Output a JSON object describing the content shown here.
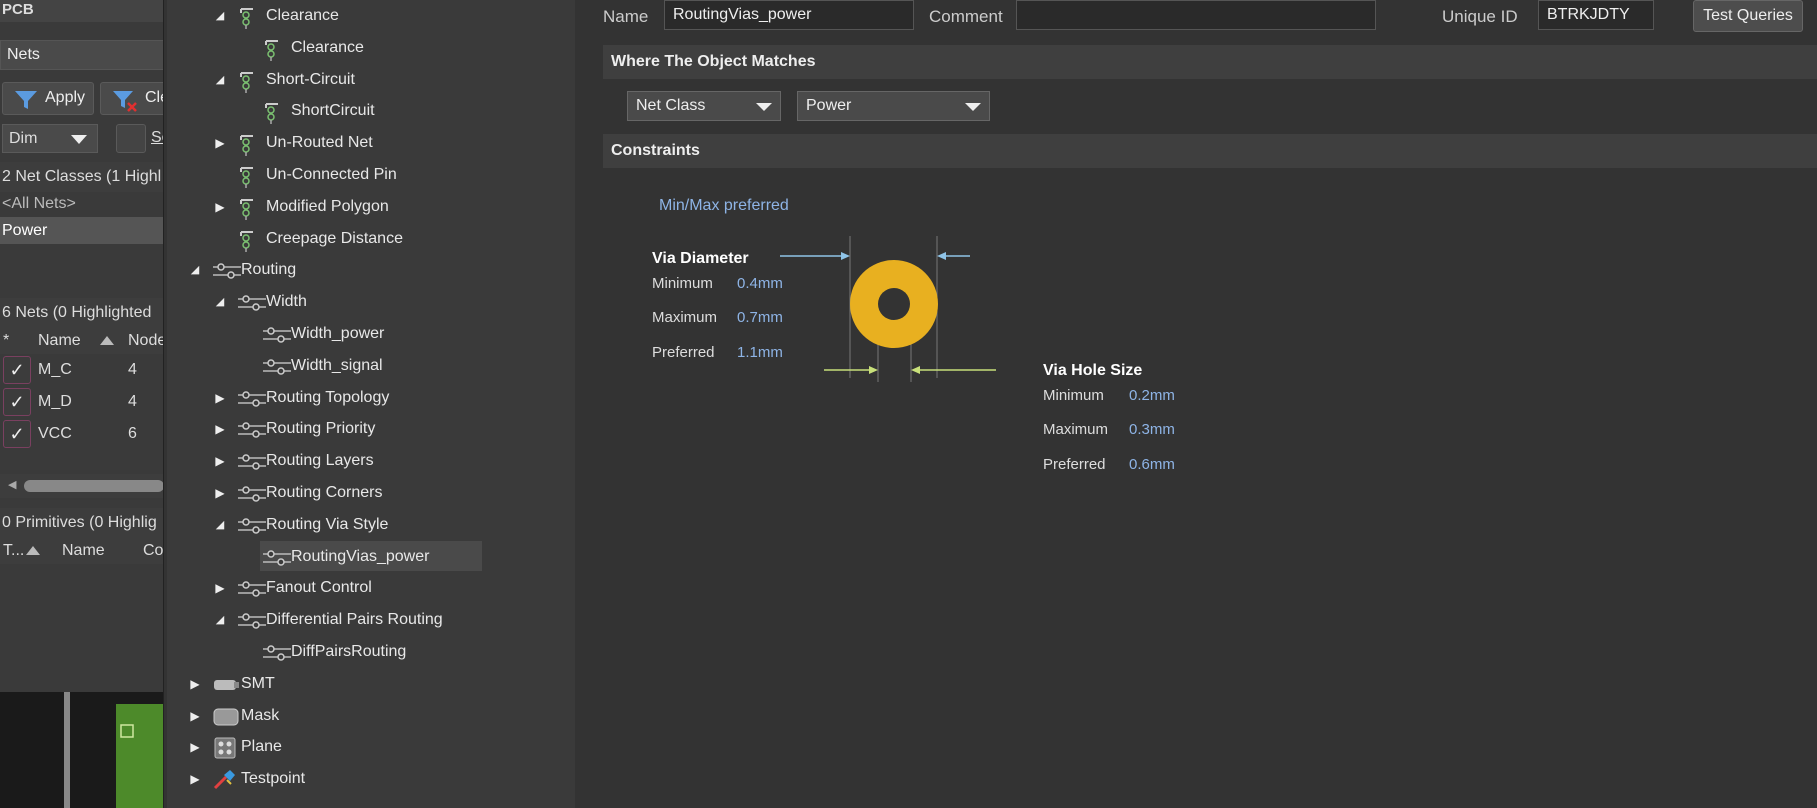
{
  "left_panel": {
    "title": "PCB",
    "mode_dropdown": "Nets",
    "apply_label": "Apply",
    "clear_label": "Cle",
    "dim_dropdown": "Dim",
    "select_label": "Se",
    "net_classes_header": "2 Net Classes (1 Highl",
    "net_classes": [
      "<All Nets>",
      "Power"
    ],
    "selected_net_class": "Power",
    "nets_header": "6 Nets (0 Highlighted",
    "nets_columns": [
      "*",
      "Name",
      "Node"
    ],
    "nets": [
      {
        "name": "M_C",
        "nodes": "4"
      },
      {
        "name": "M_D",
        "nodes": "4"
      },
      {
        "name": "VCC",
        "nodes": "6"
      }
    ],
    "primitives_header": "0 Primitives (0 Highlig",
    "primitives_columns": [
      "T...",
      "Name",
      "Co"
    ]
  },
  "tree": {
    "items": [
      {
        "label": "Clearance",
        "level": 2,
        "arrow": "expanded",
        "icon": "rule-group-icon"
      },
      {
        "label": "Clearance",
        "level": 3,
        "arrow": "none",
        "icon": "rule-icon"
      },
      {
        "label": "Short-Circuit",
        "level": 2,
        "arrow": "expanded",
        "icon": "rule-group-icon"
      },
      {
        "label": "ShortCircuit",
        "level": 3,
        "arrow": "none",
        "icon": "rule-icon"
      },
      {
        "label": "Un-Routed Net",
        "level": 2,
        "arrow": "collapsed",
        "icon": "rule-group-icon"
      },
      {
        "label": "Un-Connected Pin",
        "level": 2,
        "arrow": "none",
        "icon": "rule-group-icon"
      },
      {
        "label": "Modified Polygon",
        "level": 2,
        "arrow": "collapsed",
        "icon": "rule-group-icon"
      },
      {
        "label": "Creepage Distance",
        "level": 2,
        "arrow": "none",
        "icon": "rule-group-icon"
      },
      {
        "label": "Routing",
        "level": 1,
        "arrow": "expanded",
        "icon": "routing-icon"
      },
      {
        "label": "Width",
        "level": 2,
        "arrow": "expanded",
        "icon": "routing-icon"
      },
      {
        "label": "Width_power",
        "level": 3,
        "arrow": "none",
        "icon": "routing-icon"
      },
      {
        "label": "Width_signal",
        "level": 3,
        "arrow": "none",
        "icon": "routing-icon"
      },
      {
        "label": "Routing Topology",
        "level": 2,
        "arrow": "collapsed",
        "icon": "routing-icon"
      },
      {
        "label": "Routing Priority",
        "level": 2,
        "arrow": "collapsed",
        "icon": "routing-icon"
      },
      {
        "label": "Routing Layers",
        "level": 2,
        "arrow": "collapsed",
        "icon": "routing-icon"
      },
      {
        "label": "Routing Corners",
        "level": 2,
        "arrow": "collapsed",
        "icon": "routing-icon"
      },
      {
        "label": "Routing Via Style",
        "level": 2,
        "arrow": "expanded",
        "icon": "routing-icon"
      },
      {
        "label": "RoutingVias_power",
        "level": 3,
        "arrow": "none",
        "icon": "routing-icon",
        "selected": true
      },
      {
        "label": "Fanout Control",
        "level": 2,
        "arrow": "collapsed",
        "icon": "routing-icon"
      },
      {
        "label": "Differential Pairs Routing",
        "level": 2,
        "arrow": "expanded",
        "icon": "routing-icon"
      },
      {
        "label": "DiffPairsRouting",
        "level": 3,
        "arrow": "none",
        "icon": "routing-icon"
      },
      {
        "label": "SMT",
        "level": 1,
        "arrow": "collapsed",
        "icon": "smt-icon"
      },
      {
        "label": "Mask",
        "level": 1,
        "arrow": "collapsed",
        "icon": "mask-icon"
      },
      {
        "label": "Plane",
        "level": 1,
        "arrow": "collapsed",
        "icon": "plane-icon"
      },
      {
        "label": "Testpoint",
        "level": 1,
        "arrow": "collapsed",
        "icon": "testpoint-icon"
      }
    ]
  },
  "rule": {
    "name_label": "Name",
    "name_value": "RoutingVias_power",
    "comment_label": "Comment",
    "comment_value": "",
    "uid_label": "Unique ID",
    "uid_value": "BTRKJDTY",
    "test_queries_label": "Test Queries",
    "where_header": "Where The Object Matches",
    "match_type": "Net Class",
    "match_value": "Power",
    "constraints_header": "Constraints",
    "minmax_label": "Min/Max preferred",
    "via_diameter": {
      "title": "Via Diameter",
      "min_label": "Minimum",
      "min_value": "0.4mm",
      "max_label": "Maximum",
      "max_value": "0.7mm",
      "pref_label": "Preferred",
      "pref_value": "1.1mm"
    },
    "via_hole": {
      "title": "Via Hole Size",
      "min_label": "Minimum",
      "min_value": "0.2mm",
      "max_label": "Maximum",
      "max_value": "0.3mm",
      "pref_label": "Preferred",
      "pref_value": "0.6mm"
    },
    "colors": {
      "via_pad": "#e8b020",
      "dimension_arrow_top": "#8fc4e8",
      "dimension_arrow_bottom": "#c8e07a"
    }
  }
}
